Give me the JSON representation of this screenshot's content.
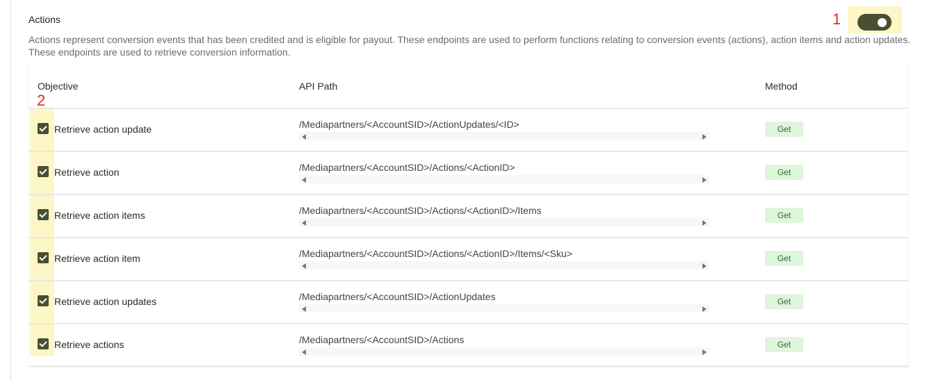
{
  "section": {
    "title": "Actions",
    "description": "Actions represent conversion events that has been credited and is eligible for payout. These endpoints are used to perform functions relating to conversion events (actions), action items and action updates. These endpoints are used to retrieve conversion information.",
    "toggle_on": true
  },
  "callouts": [
    "1",
    "2"
  ],
  "table": {
    "headers": {
      "objective": "Objective",
      "path": "API Path",
      "method": "Method"
    },
    "rows": [
      {
        "objective": "Retrieve action update",
        "path": "/Mediapartners/<AccountSID>/ActionUpdates/<ID>",
        "method": "Get",
        "checked": true
      },
      {
        "objective": "Retrieve action",
        "path": "/Mediapartners/<AccountSID>/Actions/<ActionID>",
        "method": "Get",
        "checked": true
      },
      {
        "objective": "Retrieve action items",
        "path": "/Mediapartners/<AccountSID>/Actions/<ActionID>/Items",
        "method": "Get",
        "checked": true
      },
      {
        "objective": "Retrieve action item",
        "path": "/Mediapartners/<AccountSID>/Actions/<ActionID>/Items/<Sku>",
        "method": "Get",
        "checked": true
      },
      {
        "objective": "Retrieve action updates",
        "path": "/Mediapartners/<AccountSID>/ActionUpdates",
        "method": "Get",
        "checked": true
      },
      {
        "objective": "Retrieve actions",
        "path": "/Mediapartners/<AccountSID>/Actions",
        "method": "Get",
        "checked": true
      }
    ]
  },
  "colors": {
    "accent": "#4a4f33",
    "highlight": "#fdf6c6",
    "callout": "#e4261e",
    "method_bg": "#dff5dc"
  }
}
